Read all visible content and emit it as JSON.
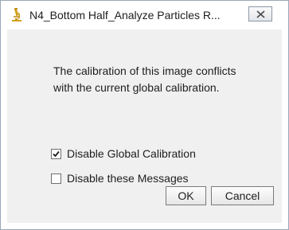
{
  "window": {
    "title": "N4_Bottom Half_Analyze Particles R...",
    "app_icon": "imagej-microscope-icon",
    "close_icon": "close-x-icon"
  },
  "dialog": {
    "message_line_1": "The calibration of this image conflicts",
    "message_line_2": "with the current global calibration.",
    "options": [
      {
        "label": "Disable Global Calibration",
        "checked": true
      },
      {
        "label": "Disable these Messages",
        "checked": false
      }
    ],
    "ok_label": "OK",
    "cancel_label": "Cancel"
  },
  "colors": {
    "dialog_background": "#f0f0f0",
    "icon_accent": "#d4a017"
  }
}
